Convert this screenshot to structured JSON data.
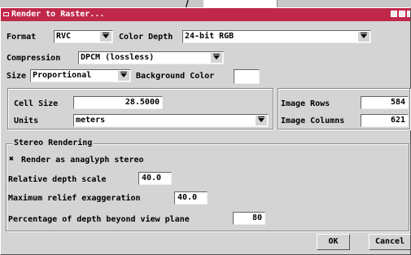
{
  "window": {
    "title": "Render to Raster..."
  },
  "format": {
    "label": "Format",
    "value": "RVC"
  },
  "color_depth": {
    "label": "Color Depth",
    "value": "24-bit RGB"
  },
  "compression": {
    "label": "Compression",
    "value": "DPCM (lossless)"
  },
  "size": {
    "label": "Size",
    "value": "Proportional",
    "bg_label": "Background Color"
  },
  "cell": {
    "size_label": "Cell Size",
    "size_value": "28.5000",
    "units_label": "Units",
    "units_value": "meters"
  },
  "image": {
    "rows_label": "Image Rows",
    "rows_value": "584",
    "cols_label": "Image Columns",
    "cols_value": "621"
  },
  "stereo": {
    "group_label": "Stereo Rendering",
    "checkbox_mark": "✖",
    "anaglyph_label": "Render as anaglyph stereo",
    "rel_depth_label": "Relative depth scale",
    "rel_depth_value": "40.0",
    "max_relief_label": "Maximum relief exaggeration",
    "max_relief_value": "40.0",
    "pct_depth_label": "Percentage of depth beyond view plane",
    "pct_depth_value": "80"
  },
  "buttons": {
    "ok": "OK",
    "cancel": "Cancel"
  },
  "colors": {
    "titlebar": "#c0284a",
    "dialog": "#d4d4d4"
  }
}
